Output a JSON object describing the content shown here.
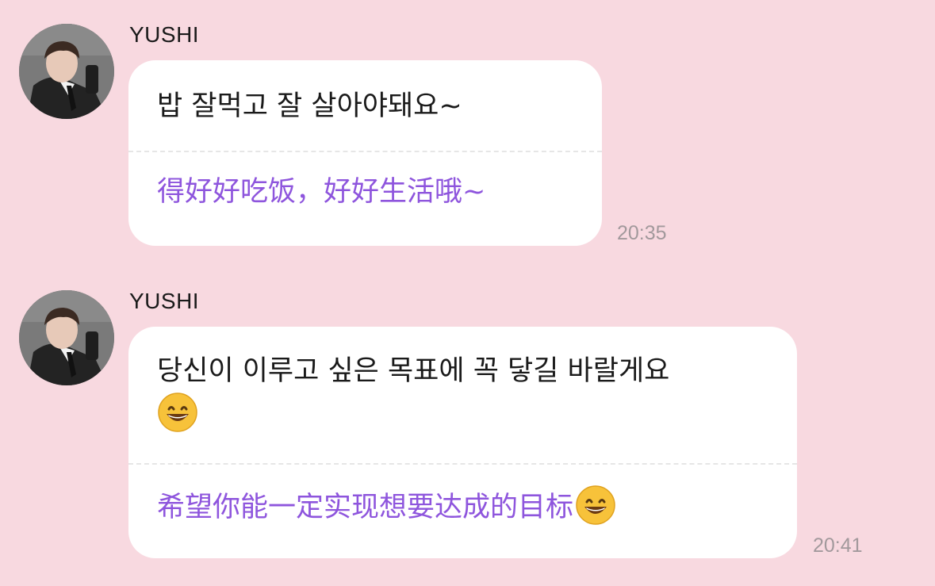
{
  "messages": [
    {
      "sender": "YUSHI",
      "original": "밥 잘먹고 잘 살아야돼요~",
      "translation": "得好好吃饭，好好生活哦~",
      "time": "20:35"
    },
    {
      "sender": "YUSHI",
      "original": "당신이 이루고 싶은 목표에 꼭 닿길 바랄게요",
      "translation": "希望你能一定实现想要达成的目标",
      "time": "20:41",
      "emoji": "grinning-face-emoji"
    }
  ],
  "colors": {
    "background": "#f8d9e0",
    "bubble": "#ffffff",
    "translation_text": "#8e55dd",
    "timestamp": "#a2999c"
  }
}
